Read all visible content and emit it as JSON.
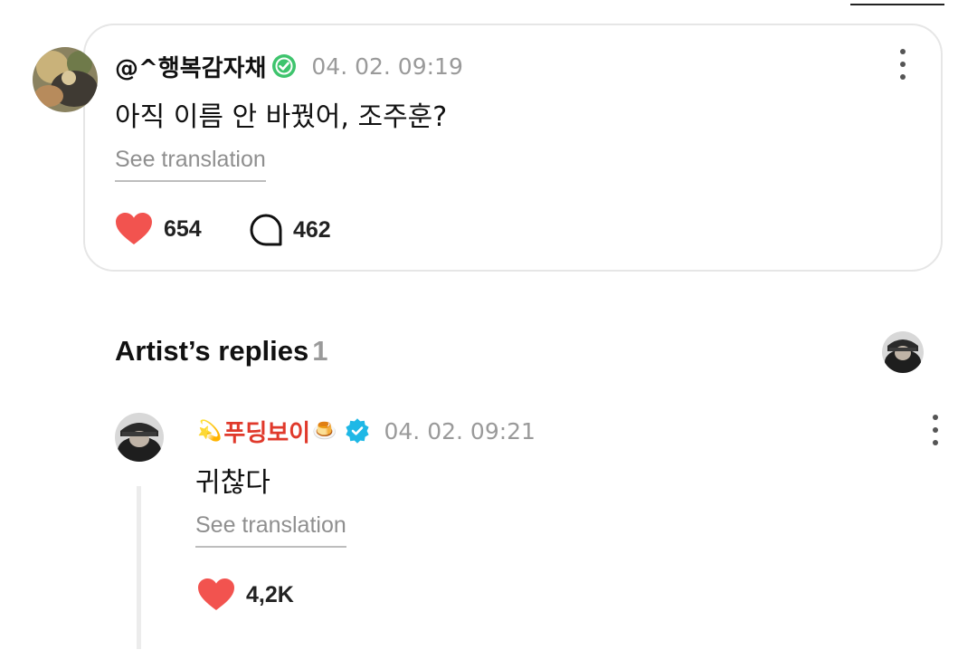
{
  "post": {
    "username": "@^행복감자채",
    "timestamp": "04. 02. 09:19",
    "message": "아직 이름 안 바꿨어, 조주훈?",
    "translate_label": "See translation",
    "likes": "654",
    "comments": "462"
  },
  "replies_section": {
    "title": "Artist’s replies",
    "count": "1"
  },
  "reply": {
    "prefix_emoji": "💫",
    "username": "푸딩보이",
    "suffix_emoji": "🍮",
    "timestamp": "04. 02. 09:21",
    "message": "귀찮다",
    "translate_label": "See translation",
    "likes": "4,2K"
  },
  "colors": {
    "heart": "#f2534f",
    "fan_badge": "#3ec46d",
    "artist_badge": "#1fb8e6",
    "artist_name": "#e0392b",
    "muted_text": "#9a9a9a"
  },
  "icons": {
    "like": "heart-icon",
    "comment": "comment-bubble-icon",
    "menu": "more-vertical-icon",
    "fan_badge": "fan-verified-badge-icon",
    "artist_badge": "artist-verified-badge-icon"
  }
}
